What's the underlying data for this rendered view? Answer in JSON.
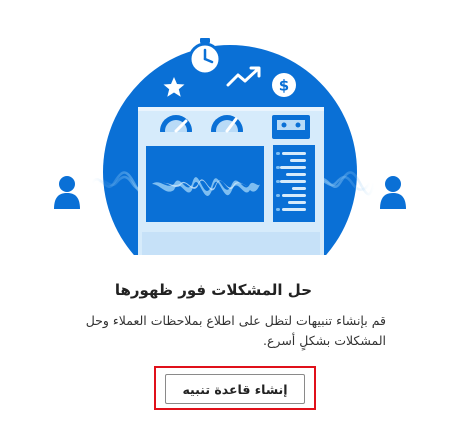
{
  "empty_state": {
    "title": "حل المشكلات فور ظهورها",
    "description": "قم بإنشاء تنبيهات لتظل على اطلاع بملاحظات العملاء وحل المشكلات بشكلٍ أسرع.",
    "create_button_label": "إنشاء قاعدة تنبيه"
  },
  "illustration": {
    "icons": [
      "stopwatch-icon",
      "star-icon",
      "trending-up-icon",
      "dollar-icon",
      "person-icon",
      "gauge-icon",
      "tape-icon",
      "waveform-icon"
    ],
    "colors": {
      "primary_blue": "#0a70d6",
      "panel_light": "#d6ebfb",
      "panel_mid": "#b9dbf7",
      "wave": "#7ebef1"
    }
  },
  "highlight_color": "#e0101a"
}
